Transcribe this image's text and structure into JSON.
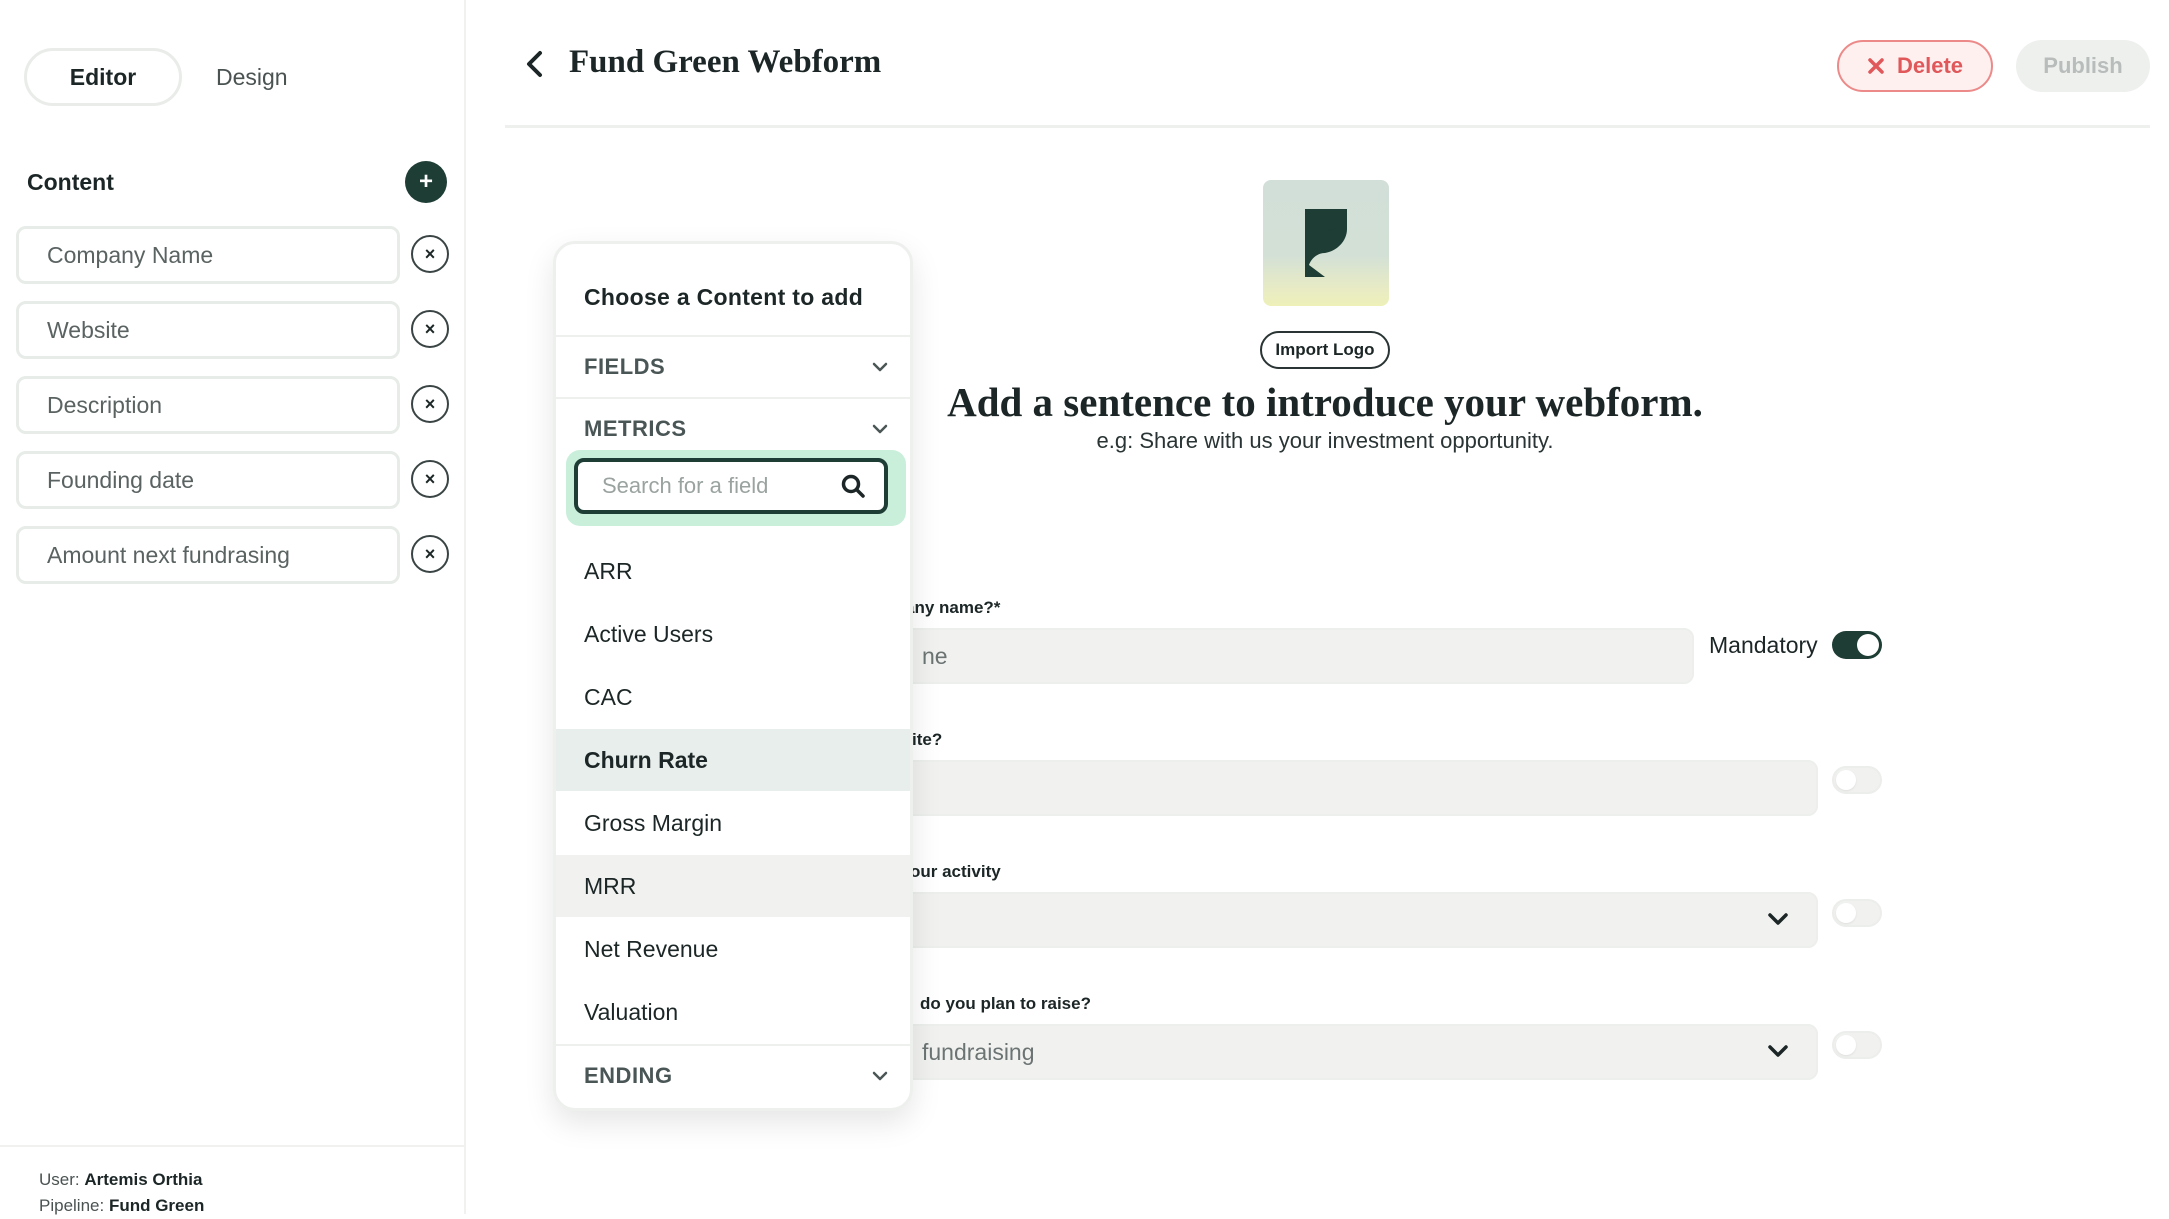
{
  "sidebar": {
    "tabs": {
      "editor": "Editor",
      "design": "Design"
    },
    "content_title": "Content",
    "add_label": "+",
    "remove_label": "×",
    "fields": [
      "Company Name",
      "Website",
      "Description",
      "Founding date",
      "Amount next fundrasing"
    ],
    "user": {
      "user_label": "User:",
      "user_name": "Artemis Orthia",
      "pipeline_label": "Pipeline:",
      "pipeline_name": "Fund Green"
    }
  },
  "header": {
    "title": "Fund Green Webform",
    "delete_label": "Delete",
    "publish_label": "Publish"
  },
  "preview": {
    "import_logo_label": "Import Logo",
    "intro_title": "Add a sentence to introduce your webform.",
    "intro_subtitle": "e.g: Share with us your investment opportunity.",
    "questions": [
      {
        "label": "any name?*",
        "value": "ne"
      },
      {
        "label": "ite?",
        "value": ""
      },
      {
        "label": "our activity",
        "value": ""
      },
      {
        "label": "do you plan to raise?",
        "value": "fundraising"
      }
    ],
    "mandatory_label": "Mandatory",
    "toggles": [
      true,
      false,
      false,
      false
    ]
  },
  "popup": {
    "title": "Choose a Content to add",
    "sections": {
      "fields": "FIELDS",
      "metrics": "METRICS",
      "ending": "ENDING"
    },
    "search_placeholder": "Search for a field",
    "metrics": [
      "ARR",
      "Active Users",
      "CAC",
      "Churn Rate",
      "Gross Margin",
      "MRR",
      "Net Revenue",
      "Valuation"
    ],
    "hovered_metric": "Churn Rate",
    "highlighted_metric": "MRR"
  },
  "colors": {
    "accent": "#1e3d35",
    "danger": "#e0585a",
    "search_focus": "#c9efdb",
    "hover_row": "#e8eeeb"
  }
}
